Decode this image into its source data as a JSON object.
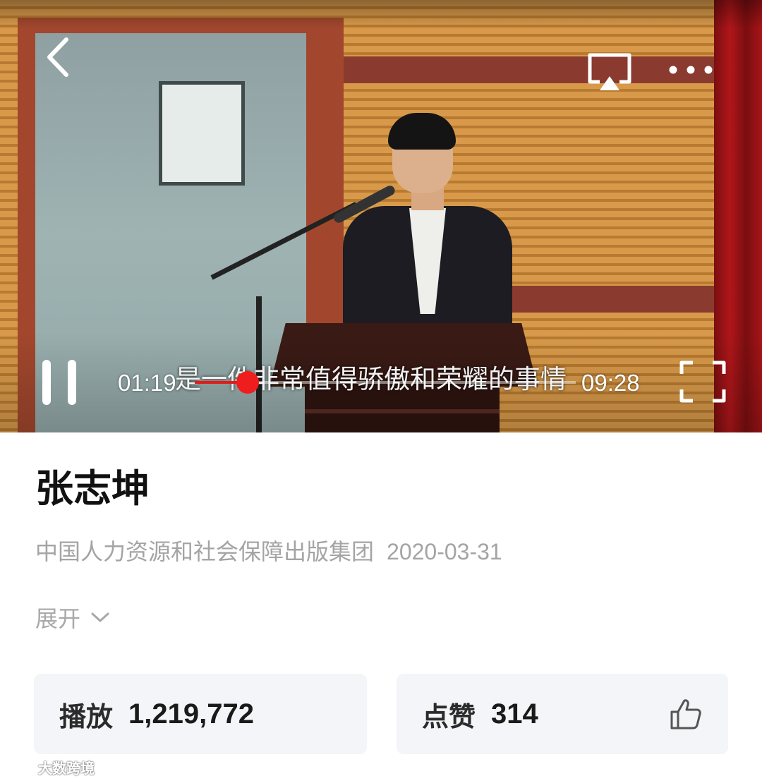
{
  "player": {
    "current_time": "01:19",
    "total_time": "09:28",
    "progress_fraction": 0.139,
    "subtitle": "是一件非常值得骄傲和荣耀的事情",
    "accent_color": "#e21b1b",
    "icons": {
      "back": "back-chevron-icon",
      "cast": "airplay-icon",
      "more": "more-dots-icon",
      "pause": "pause-icon",
      "fullscreen": "fullscreen-icon"
    }
  },
  "video_info": {
    "title": "张志坤",
    "publisher": "中国人力资源和社会保障出版集团",
    "date": "2020-03-31",
    "expand_label": "展开"
  },
  "stats": {
    "plays_label": "播放",
    "plays_value": "1,219,772",
    "likes_label": "点赞",
    "likes_value": "314"
  },
  "watermark": {
    "text": "大数跨境"
  }
}
